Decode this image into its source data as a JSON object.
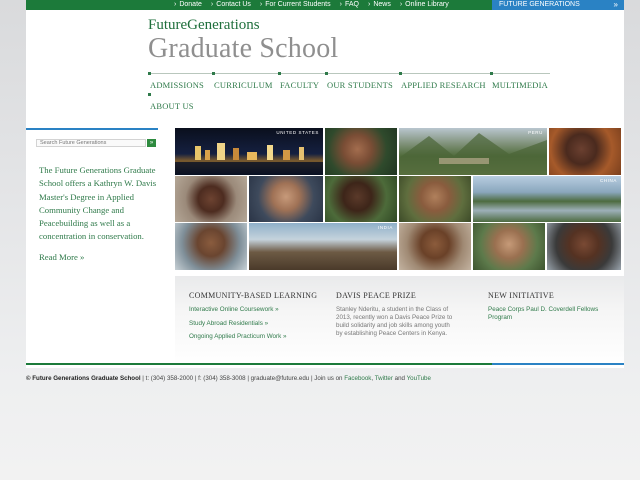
{
  "topnav": {
    "links": [
      "Donate",
      "Contact Us",
      "For Current Students",
      "FAQ",
      "News",
      "Online Library"
    ],
    "chevron": "›",
    "fg_tab": "FUTURE GENERATIONS",
    "fg_tab_arrow": "»"
  },
  "logo": {
    "line1": "FutureGenerations",
    "line2": "Graduate School"
  },
  "mainnav": {
    "row1": [
      "ADMISSIONS",
      "CURRICULUM",
      "FACULTY",
      "OUR STUDENTS",
      "APPLIED RESEARCH",
      "MULTIMEDIA"
    ],
    "row2": [
      "ABOUT US"
    ]
  },
  "sidebar": {
    "search_placeholder": "Search Future Generations",
    "search_button": "»",
    "intro": "The Future Generations Graduate School offers a Kathryn W. Davis Master's Degree in Applied Community Change and Peacebuilding as well as a concentration in conservation.",
    "read_more": "Read More »"
  },
  "photos": {
    "labels": [
      "UNITED STATES",
      "PERU",
      "CHINA",
      "INDIA"
    ]
  },
  "columns": {
    "learning": {
      "heading": "COMMUNITY-BASED LEARNING",
      "links": [
        "Interactive Online Coursework »",
        "Study Abroad Residentials »",
        "Ongoing Applied Practicum Work »"
      ]
    },
    "prize": {
      "heading": "DAVIS PEACE PRIZE",
      "text1": "Stanley Nderitu, a student in the Class of",
      "text2": "2013, recently won a Davis Peace Prize to",
      "text3": "build solidarity and job skills among youth",
      "text4": "by establishing Peace Centers in Kenya."
    },
    "initiative": {
      "heading": "NEW INITIATIVE",
      "link1": "Peace Corps Paul D. Coverdell Fellows",
      "link2": "Program"
    }
  },
  "footer": {
    "org": "© Future Generations Graduate School",
    "contact": " | t: (304) 358-2000 | f: (304) 358-3008 | graduate@future.edu | Join us on ",
    "facebook": "Facebook",
    "comma": ", ",
    "twitter": "Twitter",
    "and": " and ",
    "youtube": "YouTube"
  },
  "colors": {
    "green": "#1c7a3a",
    "blue": "#2a82c4",
    "link_green": "#2f7a4a"
  }
}
